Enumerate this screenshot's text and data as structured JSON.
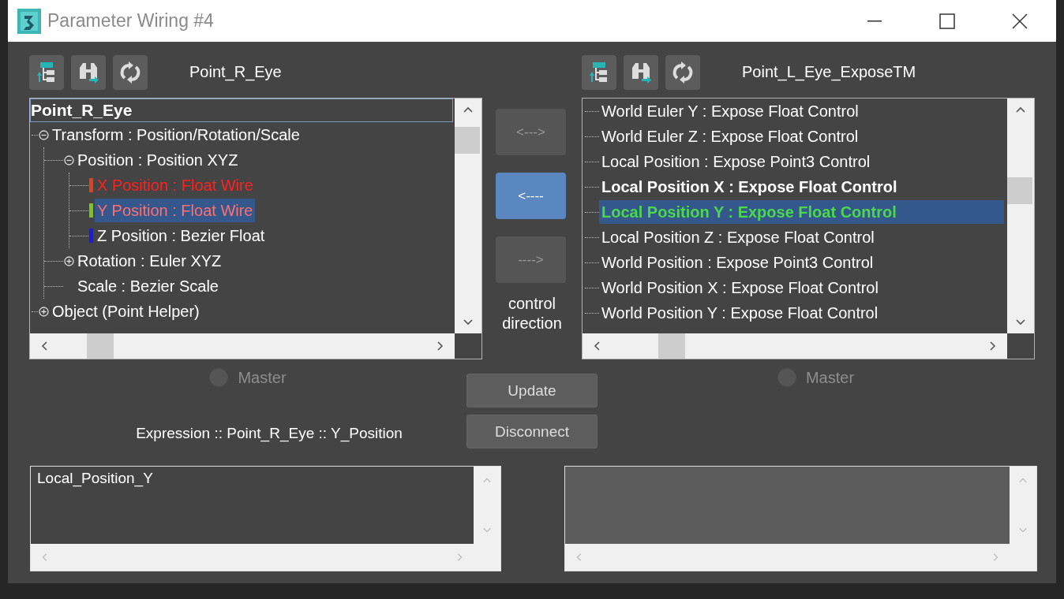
{
  "window": {
    "title": "Parameter Wiring #4"
  },
  "left_panel": {
    "title": "Point_R_Eye",
    "tree": [
      {
        "label": "Point_R_Eye",
        "kind": "root",
        "focused": true,
        "children": [
          {
            "label": "Transform : Position/Rotation/Scale",
            "kind": "node",
            "expanded": true,
            "selected": false,
            "children": [
              {
                "label": "Position : Position XYZ",
                "kind": "node",
                "expanded": true,
                "selected": false,
                "children": [
                  {
                    "label": "X Position : Float Wire",
                    "kind": "channel",
                    "color": "#e0401a",
                    "wired": true,
                    "selected": false
                  },
                  {
                    "label": "Y Position : Float Wire",
                    "kind": "channel",
                    "color": "#7cc61c",
                    "wired": true,
                    "selected": true
                  },
                  {
                    "label": "Z Position : Bezier Float",
                    "kind": "channel",
                    "color": "#1a1ae8",
                    "wired": false,
                    "selected": false
                  }
                ]
              },
              {
                "label": "Rotation : Euler XYZ",
                "kind": "node",
                "expanded": false,
                "selected": false
              },
              {
                "label": "Scale : Bezier Scale",
                "kind": "leaf",
                "selected": false
              }
            ]
          },
          {
            "label": "Object (Point Helper)",
            "kind": "node",
            "expanded": false,
            "selected": false
          }
        ]
      }
    ],
    "master": {
      "label": "Master",
      "checked": false
    }
  },
  "direction": {
    "buttons": [
      {
        "label": "<--->",
        "selected": false
      },
      {
        "label": "<----",
        "selected": true
      },
      {
        "label": "---->",
        "selected": false
      }
    ],
    "caption": "control direction"
  },
  "right_panel": {
    "title": "Point_L_Eye_ExposeTM",
    "items": [
      {
        "label": "World Euler Y : Expose Float Control",
        "bold": false,
        "wired": false,
        "selected": false
      },
      {
        "label": "World Euler Z : Expose Float Control",
        "bold": false,
        "wired": false,
        "selected": false
      },
      {
        "label": "Local Position : Expose Point3 Control",
        "bold": false,
        "wired": false,
        "selected": false
      },
      {
        "label": "Local Position X : Expose Float Control",
        "bold": true,
        "wired": false,
        "selected": false
      },
      {
        "label": "Local Position Y : Expose Float Control",
        "bold": true,
        "wired": true,
        "selected": true
      },
      {
        "label": "Local Position Z : Expose Float Control",
        "bold": false,
        "wired": false,
        "selected": false
      },
      {
        "label": "World Position : Expose Point3 Control",
        "bold": false,
        "wired": false,
        "selected": false
      },
      {
        "label": "World Position X : Expose Float Control",
        "bold": false,
        "wired": false,
        "selected": false
      },
      {
        "label": "World Position Y : Expose Float Control",
        "bold": false,
        "wired": false,
        "selected": false
      }
    ],
    "master": {
      "label": "Master",
      "checked": false
    }
  },
  "actions": [
    "Update",
    "Disconnect"
  ],
  "expression": {
    "label": "Expression :: Point_R_Eye :: Y_Position",
    "editors": [
      {
        "value": "Local_Position_Y",
        "disabled": false
      },
      {
        "disabled": true
      }
    ]
  }
}
